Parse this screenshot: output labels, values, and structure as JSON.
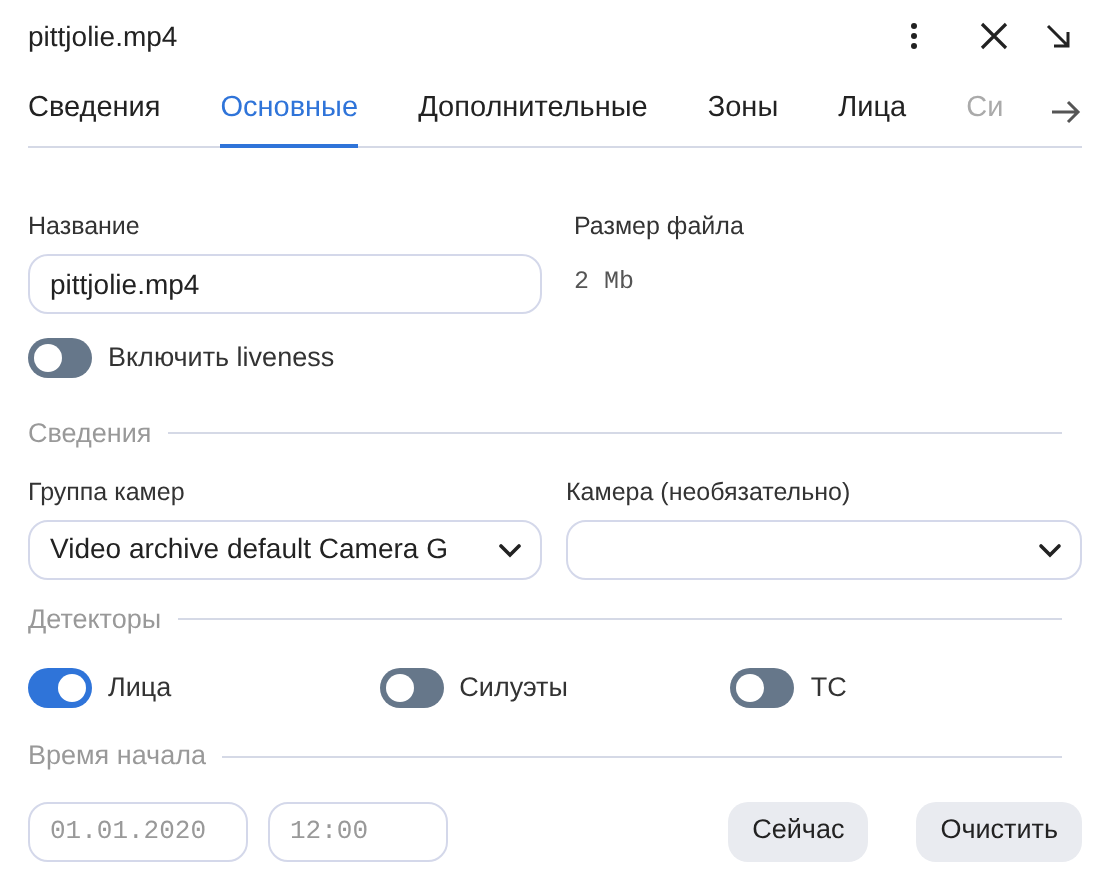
{
  "window": {
    "title": "pittjolie.mp4"
  },
  "tabs": [
    {
      "label": "Сведения",
      "selected": false
    },
    {
      "label": "Основные",
      "selected": true
    },
    {
      "label": "Дополнительные",
      "selected": false
    },
    {
      "label": "Зоны",
      "selected": false
    },
    {
      "label": "Лица",
      "selected": false
    },
    {
      "label": "Си",
      "selected": false,
      "faded": true
    }
  ],
  "name_field": {
    "label": "Название",
    "value": "pittjolie.mp4"
  },
  "file_size": {
    "label": "Размер файла",
    "value": "2 Mb"
  },
  "liveness": {
    "label": "Включить liveness",
    "on": false
  },
  "info_section": {
    "title": "Сведения"
  },
  "camera_group": {
    "label": "Группа камер",
    "value": "Video archive default Camera G"
  },
  "camera": {
    "label": "Камера (необязательно)"
  },
  "detectors": {
    "title": "Детекторы",
    "items": [
      {
        "label": "Лица",
        "on": true
      },
      {
        "label": "Силуэты",
        "on": false
      },
      {
        "label": "ТС",
        "on": false
      }
    ]
  },
  "start_time": {
    "title": "Время начала",
    "date_placeholder": "01.01.2020",
    "time_placeholder": "12:00"
  },
  "buttons": [
    "Сейчас",
    "Очистить"
  ]
}
